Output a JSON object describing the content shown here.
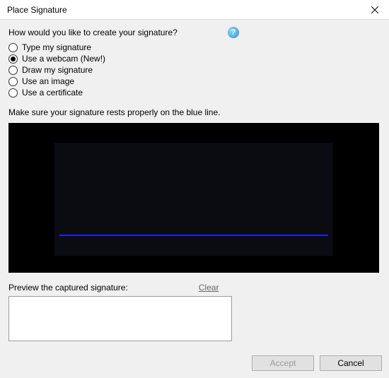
{
  "window": {
    "title": "Place Signature"
  },
  "prompt": "How would you like to create your signature?",
  "help_icon_glyph": "?",
  "options": {
    "type": "Type my signature",
    "webcam": "Use a webcam (New!)",
    "draw": "Draw my signature",
    "image": "Use an image",
    "cert": "Use a certificate",
    "selected": "webcam"
  },
  "instruction": "Make sure your signature rests properly on the blue line.",
  "preview": {
    "label": "Preview the captured signature:",
    "clear": "Clear"
  },
  "buttons": {
    "accept": "Accept",
    "cancel": "Cancel"
  }
}
